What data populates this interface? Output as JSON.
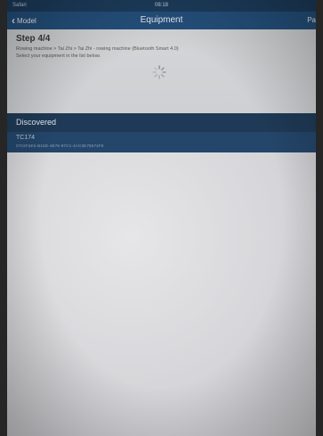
{
  "status_bar": {
    "left": "Safari",
    "time": "08:18",
    "right": ""
  },
  "nav": {
    "back_label": "Model",
    "title": "Equipment",
    "right_label": "Pa"
  },
  "step": {
    "title": "Step 4/4",
    "path": "Rowing machine > Tai Zhi > Tai Zhi - rowing machine (Bluetooth Smart 4.0)",
    "instruction": "Select your equipment in the list below."
  },
  "section": {
    "title": "Discovered"
  },
  "devices": [
    {
      "name": "TC174",
      "id": "0702F6E5-B16D-4E76-97C1-4AC0E78674F9"
    }
  ],
  "icons": {
    "back": "chevron-left-icon",
    "spinner": "loading-spinner-icon"
  },
  "colors": {
    "nav_bar": "#24507c",
    "section_header": "#1f3a56",
    "device_row": "#24466a",
    "panel": "#d4d5d7"
  }
}
